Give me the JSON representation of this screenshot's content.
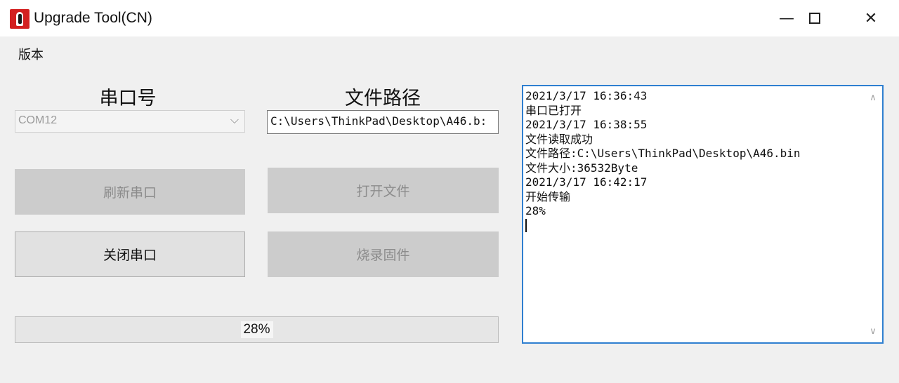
{
  "window": {
    "title": "Upgrade Tool(CN)",
    "minimize_icon": "minimize-icon",
    "maximize_icon": "maximize-icon",
    "close_icon": "close-icon"
  },
  "menu": {
    "items": [
      {
        "label": "版本"
      }
    ]
  },
  "serial": {
    "label": "串口号",
    "port_value": "COM12",
    "refresh_button": "刷新串口",
    "toggle_button": "关闭串口"
  },
  "file": {
    "label": "文件路径",
    "path_value": "C:\\Users\\ThinkPad\\Desktop\\A46.b:",
    "open_button": "打开文件",
    "flash_button": "烧录固件"
  },
  "progress": {
    "value": 28,
    "text": "28%"
  },
  "log": {
    "lines": [
      "2021/3/17 16:36:43",
      "串口已打开",
      "2021/3/17 16:38:55",
      "文件读取成功",
      "文件路径:C:\\Users\\ThinkPad\\Desktop\\A46.bin",
      "文件大小:36532Byte",
      "2021/3/17 16:42:17",
      "开始传输",
      "28%"
    ]
  },
  "colors": {
    "log_border": "#2f7fd0",
    "disabled_button": "#cccccc",
    "app_icon": "#d32020"
  }
}
